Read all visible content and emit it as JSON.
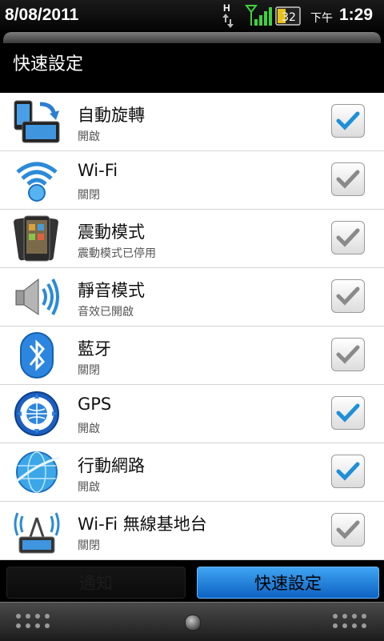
{
  "status_bar": {
    "date": "8/08/2011",
    "network_indicator": "H",
    "battery_level": "32",
    "ampm": "下午",
    "time": "1:29",
    "icons": [
      "network-h-icon",
      "signal-icon",
      "battery-icon"
    ]
  },
  "header": {
    "title": "快速設定"
  },
  "settings": [
    {
      "id": "auto-rotate",
      "title": "自動旋轉",
      "subtitle": "開啟",
      "checked": true,
      "icon": "rotate-icon"
    },
    {
      "id": "wifi",
      "title": "Wi-Fi",
      "subtitle": "關閉",
      "checked": false,
      "icon": "wifi-icon"
    },
    {
      "id": "vibrate",
      "title": "震動模式",
      "subtitle": "震動模式已停用",
      "checked": false,
      "icon": "vibrate-icon"
    },
    {
      "id": "silent",
      "title": "靜音模式",
      "subtitle": "音效已開啟",
      "checked": false,
      "icon": "speaker-icon"
    },
    {
      "id": "bluetooth",
      "title": "藍牙",
      "subtitle": "關閉",
      "checked": false,
      "icon": "bluetooth-icon"
    },
    {
      "id": "gps",
      "title": "GPS",
      "subtitle": "開啟",
      "checked": true,
      "icon": "gps-icon"
    },
    {
      "id": "mobile-network",
      "title": "行動網路",
      "subtitle": "開啟",
      "checked": true,
      "icon": "globe-icon"
    },
    {
      "id": "wifi-hotspot",
      "title": "Wi-Fi 無線基地台",
      "subtitle": "關閉",
      "checked": false,
      "icon": "hotspot-icon"
    }
  ],
  "tabs": {
    "notifications": "通知",
    "quick_settings": "快速設定",
    "active": "quick_settings"
  },
  "colors": {
    "check_on": "#1f8fd8",
    "check_off": "#8a8a8a",
    "tab_active": "#2b86e0"
  }
}
